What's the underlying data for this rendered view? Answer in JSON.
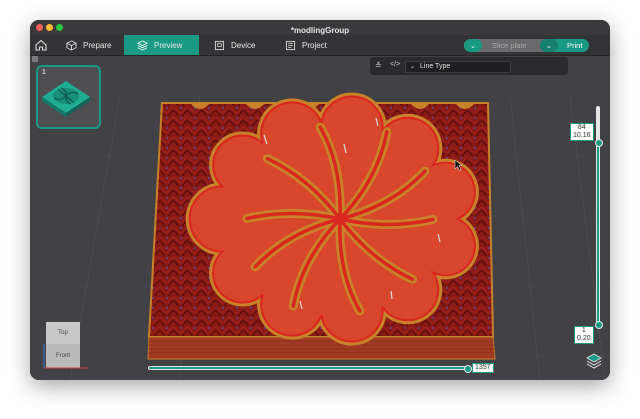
{
  "window": {
    "title": "*modlingGroup"
  },
  "toolbar": {
    "tabs": [
      {
        "label": "Prepare",
        "icon": "cube-icon"
      },
      {
        "label": "Preview",
        "icon": "layers-cube-icon",
        "active": true
      },
      {
        "label": "Device",
        "icon": "device-icon"
      },
      {
        "label": "Project",
        "icon": "project-icon"
      }
    ],
    "slice_label": "Slice plate",
    "print_label": "Print"
  },
  "plate": {
    "number": "1"
  },
  "legend": {
    "select_value": "Line Type"
  },
  "layer_slider": {
    "top_layer": "84",
    "top_height": "10.16",
    "bottom_layer": "1",
    "bottom_height": "0.20"
  },
  "move_slider": {
    "value": "1357"
  },
  "view_cube": {
    "top": "Top",
    "front": "Front"
  },
  "colors": {
    "accent": "#1a9a84",
    "inner_wall": "#d9261e",
    "outer_wall": "#c8822a",
    "sparse_infill": "#8a1a16",
    "bottom_surface": "#d8472c"
  }
}
